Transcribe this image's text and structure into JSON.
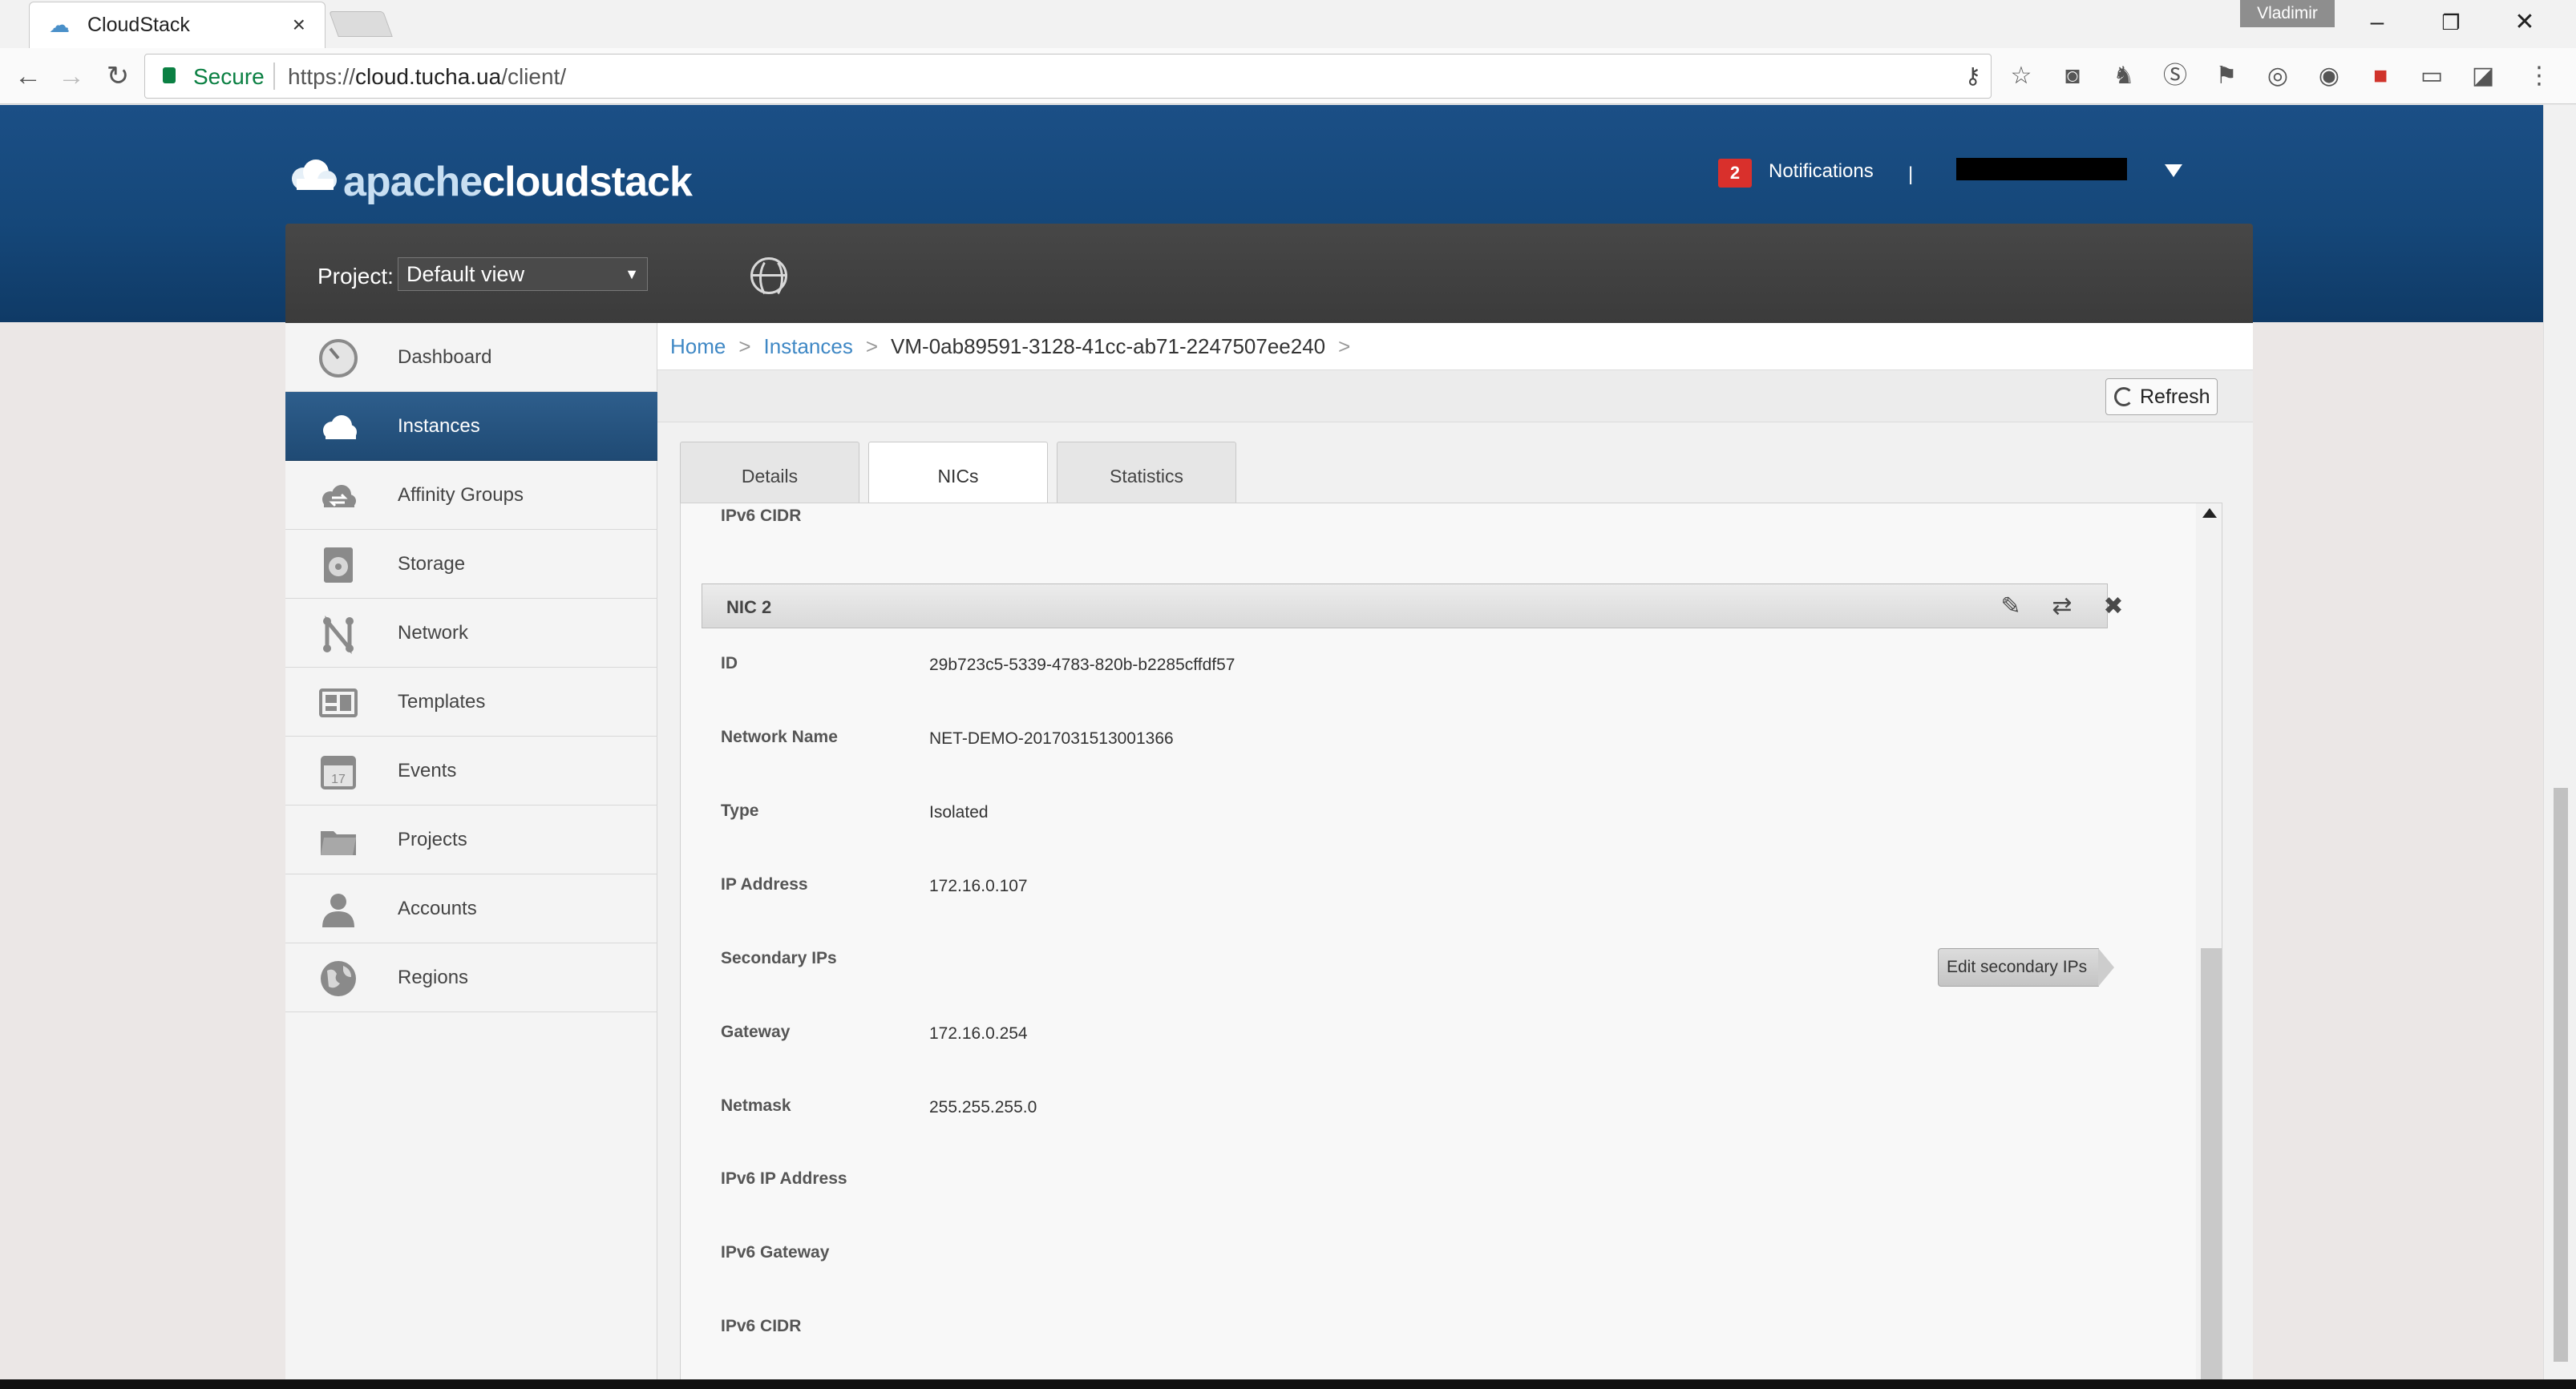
{
  "browser": {
    "tab_title": "CloudStack",
    "tab_close": "×",
    "profile_name": "Vladimir",
    "secure_label": "Secure",
    "url_scheme": "https://",
    "url_host": "cloud.tucha.ua",
    "url_path": "/client/"
  },
  "header": {
    "logo_part1": "apache",
    "logo_part2": "cloudstack",
    "notifications_count": "2",
    "notifications_label": "Notifications",
    "divider": "|"
  },
  "project": {
    "label": "Project:",
    "selected": "Default view"
  },
  "sidebar": {
    "items": [
      {
        "label": "Dashboard",
        "icon": "dashboard-icon"
      },
      {
        "label": "Instances",
        "icon": "cloud-icon"
      },
      {
        "label": "Affinity Groups",
        "icon": "affinity-icon"
      },
      {
        "label": "Storage",
        "icon": "storage-icon"
      },
      {
        "label": "Network",
        "icon": "network-icon"
      },
      {
        "label": "Templates",
        "icon": "templates-icon"
      },
      {
        "label": "Events",
        "icon": "calendar-icon"
      },
      {
        "label": "Projects",
        "icon": "folder-icon"
      },
      {
        "label": "Accounts",
        "icon": "user-icon"
      },
      {
        "label": "Regions",
        "icon": "globe-icon"
      }
    ],
    "active_index": 1
  },
  "breadcrumb": {
    "home": "Home",
    "instances": "Instances",
    "current": "VM-0ab89591-3128-41cc-ab71-2247507ee240",
    "sep": ">"
  },
  "toolbar": {
    "refresh_label": "Refresh"
  },
  "tabs": [
    {
      "label": "Details"
    },
    {
      "label": "NICs"
    },
    {
      "label": "Statistics"
    }
  ],
  "nic_panel": {
    "prev_label": "IPv6 CIDR",
    "nic_title": "NIC 2",
    "rows": [
      {
        "label": "ID",
        "value": "29b723c5-5339-4783-820b-b2285cffdf57"
      },
      {
        "label": "Network Name",
        "value": "NET-DEMO-2017031513001366"
      },
      {
        "label": "Type",
        "value": "Isolated"
      },
      {
        "label": "IP Address",
        "value": "172.16.0.107"
      },
      {
        "label": "Secondary IPs",
        "value": ""
      },
      {
        "label": "Gateway",
        "value": "172.16.0.254"
      },
      {
        "label": "Netmask",
        "value": "255.255.255.0"
      },
      {
        "label": "IPv6 IP Address",
        "value": ""
      },
      {
        "label": "IPv6 Gateway",
        "value": ""
      },
      {
        "label": "IPv6 CIDR",
        "value": ""
      }
    ],
    "edit_secondary_label": "Edit secondary IPs"
  }
}
